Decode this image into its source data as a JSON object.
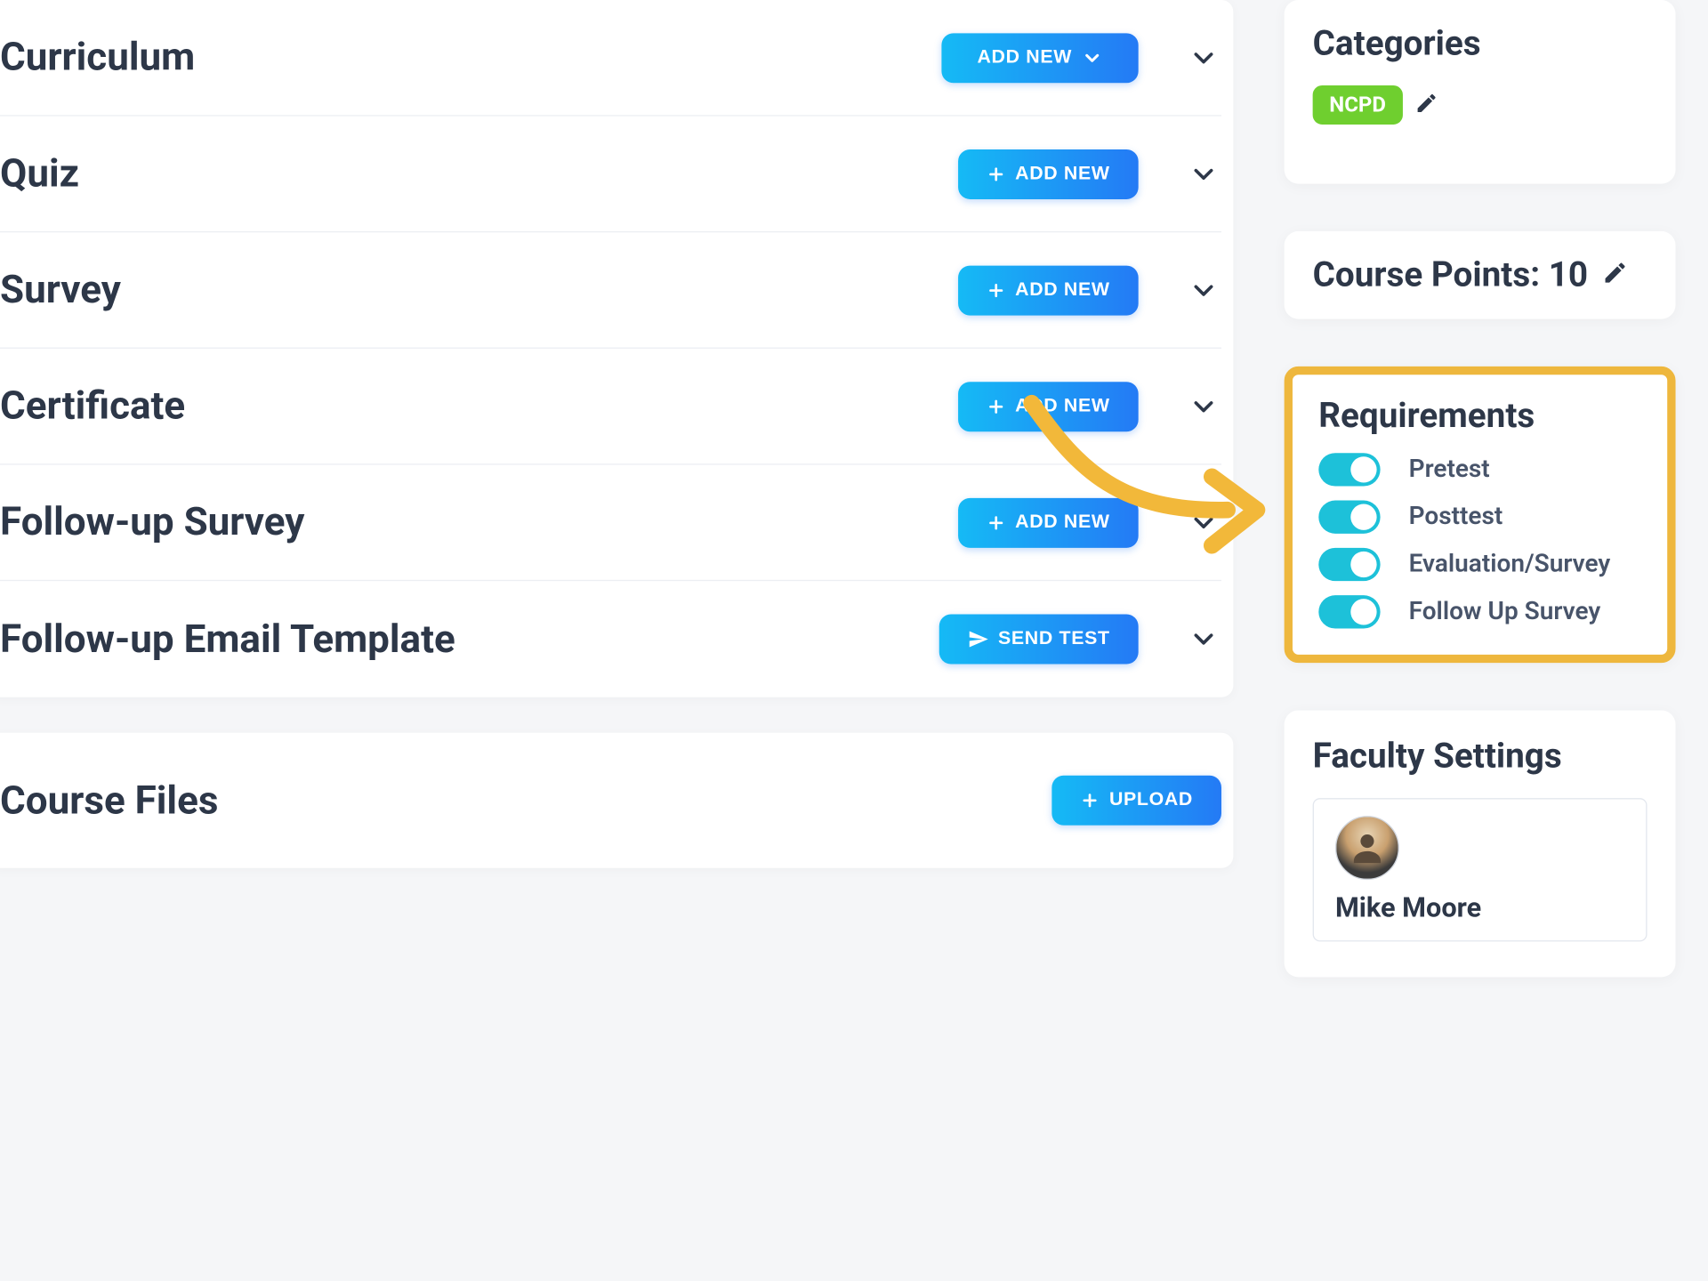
{
  "sections": [
    {
      "id": "curriculum",
      "title": "Curriculum",
      "button": {
        "type": "dropdown",
        "label": "ADD NEW"
      }
    },
    {
      "id": "quiz",
      "title": "Quiz",
      "button": {
        "type": "add",
        "label": "ADD NEW"
      }
    },
    {
      "id": "survey",
      "title": "Survey",
      "button": {
        "type": "add",
        "label": "ADD NEW"
      }
    },
    {
      "id": "certificate",
      "title": "Certificate",
      "button": {
        "type": "add",
        "label": "ADD NEW"
      }
    },
    {
      "id": "followup-survey",
      "title": "Follow-up Survey",
      "button": {
        "type": "add",
        "label": "ADD NEW"
      }
    },
    {
      "id": "followup-email",
      "title": "Follow-up Email Template",
      "button": {
        "type": "send",
        "label": "SEND TEST"
      }
    }
  ],
  "course_files": {
    "title": "Course Files",
    "upload_label": "UPLOAD"
  },
  "sidebar": {
    "categories": {
      "title": "Categories",
      "tag": "NCPD"
    },
    "course_points": {
      "label_prefix": "Course Points:",
      "value": "10"
    },
    "requirements": {
      "title": "Requirements",
      "items": [
        {
          "label": "Pretest",
          "on": true
        },
        {
          "label": "Posttest",
          "on": true
        },
        {
          "label": "Evaluation/Survey",
          "on": true
        },
        {
          "label": "Follow Up Survey",
          "on": true
        }
      ]
    },
    "faculty": {
      "title": "Faculty Settings",
      "name": "Mike Moore"
    }
  }
}
